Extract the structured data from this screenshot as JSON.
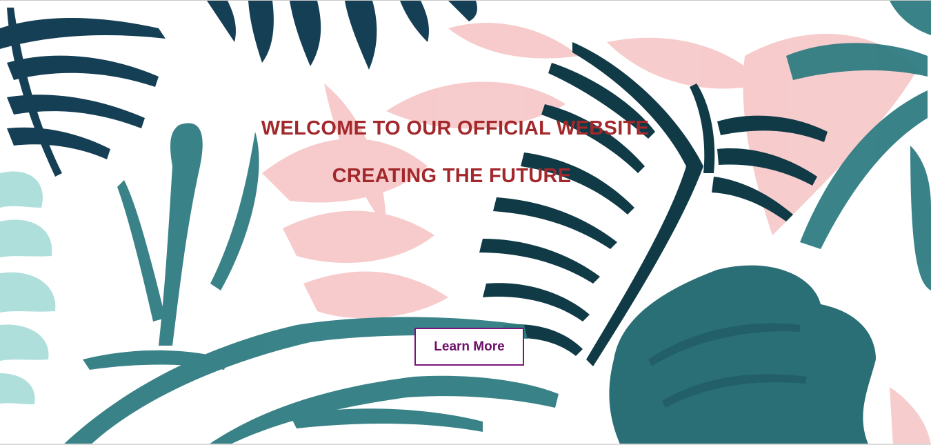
{
  "hero": {
    "headline_1": "WELCOME TO OUR OFFICIAL WEBSITE",
    "headline_2": "CREATING THE FUTURE",
    "cta_label": "Learn More"
  },
  "colors": {
    "headline": "#a3282b",
    "cta_text": "#6b0f6b",
    "cta_border": "#7b137b",
    "leaf_dark": "#12394b",
    "leaf_teal": "#2f7b80",
    "leaf_mint": "#a9dcd8",
    "leaf_pink": "#f6c4c4"
  },
  "icons": {
    "background": "tropical-leaves-illustration"
  }
}
